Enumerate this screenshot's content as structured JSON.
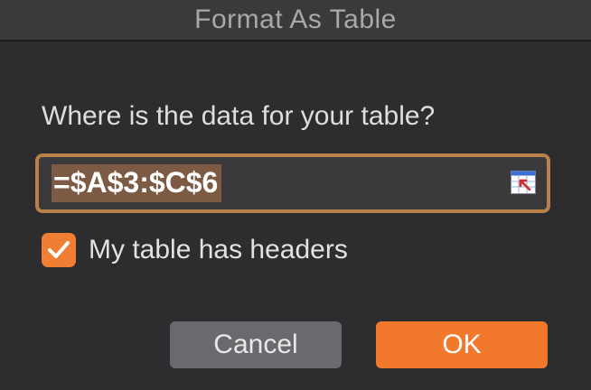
{
  "dialog": {
    "title": "Format As Table",
    "prompt": "Where is the data for your table?",
    "range_value": "=$A$3:$C$6",
    "headers_checkbox": {
      "label": "My table has headers",
      "checked": true
    },
    "buttons": {
      "cancel_label": "Cancel",
      "ok_label": "OK"
    }
  },
  "colors": {
    "accent": "#f2782c",
    "field_border": "#b9804a",
    "background": "#2d2d2f"
  },
  "icons": {
    "collapse_dialog": "range-select-icon",
    "checkmark": "checkmark-icon"
  }
}
